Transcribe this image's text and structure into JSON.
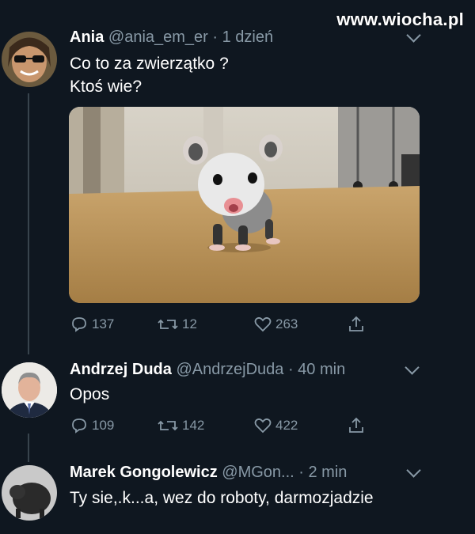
{
  "watermark": "www.wiocha.pl",
  "tweets": [
    {
      "name": "Ania",
      "handle": "@ania_em_er",
      "time": "· 1 dzień",
      "lines": [
        "Co to za zwierzątko ?",
        "Ktoś wie?"
      ],
      "replies": "137",
      "retweets": "12",
      "likes": "263"
    },
    {
      "name": "Andrzej Duda",
      "handle": "@AndrzejDuda",
      "time": "· 40 min",
      "lines": [
        "Opos"
      ],
      "replies": "109",
      "retweets": "142",
      "likes": "422"
    },
    {
      "name": "Marek Gongolewicz",
      "handle": "@MGon...",
      "time": "· 2 min",
      "lines": [
        "Ty sie,.k...a, wez do roboty, darmozjadzie"
      ]
    }
  ],
  "icons": {
    "reply": "reply-icon",
    "retweet": "retweet-icon",
    "like": "like-icon",
    "share": "share-icon",
    "more": "chevron-down-icon"
  },
  "colors": {
    "background": "#0f1720",
    "muted": "#8899a6",
    "text": "#ffffff"
  }
}
